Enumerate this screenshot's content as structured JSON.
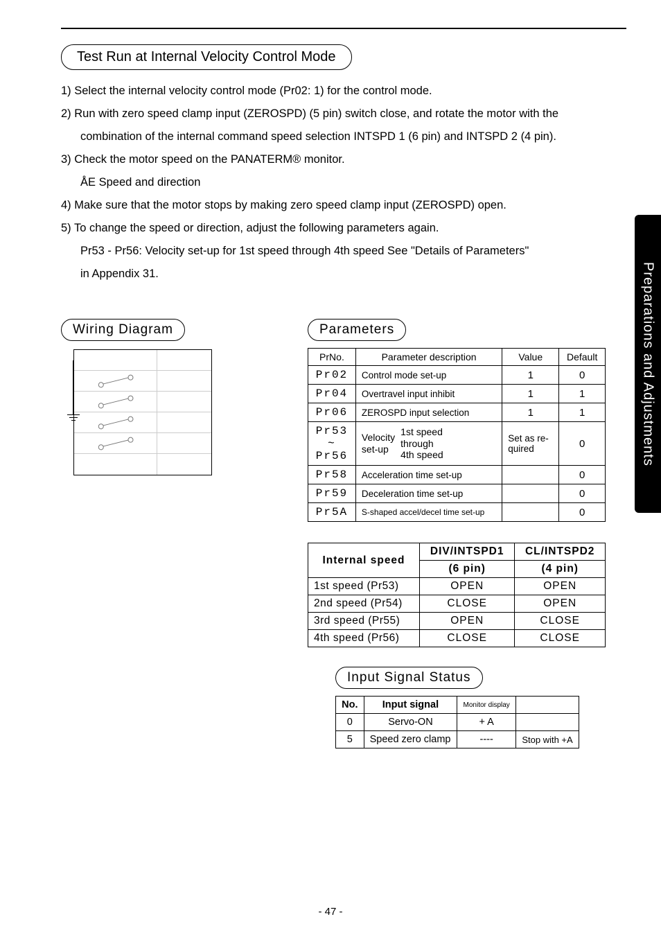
{
  "side_tab": "Preparations and Adjustments",
  "section_title": "Test Run at Internal Velocity Control Mode",
  "steps": {
    "s1": "1) Select the internal velocity control mode (Pr02: 1) for the control mode.",
    "s2": "2) Run with zero speed clamp input (ZEROSPD) (5 pin) switch close, and rotate the motor with the",
    "s2b": "combination of the internal command speed selection INTSPD 1 (6 pin) and INTSPD 2 (4 pin).",
    "s3": "3) Check the motor speed on the PANATERM® monitor.",
    "s3b": "ÅE Speed and direction",
    "s4": "4) Make sure that the motor stops by making zero speed clamp input (ZEROSPD) open.",
    "s5": "5) To change the speed or direction, adjust the following parameters again.",
    "s5b": "Pr53 - Pr56:  Velocity set-up for 1st speed through 4th speed  See \"Details of Parameters\"",
    "s5c": "in Appendix 31."
  },
  "wiring_heading": "Wiring Diagram",
  "params_heading": "Parameters",
  "params_headers": {
    "prno": "PrNo.",
    "desc": "Parameter description",
    "value": "Value",
    "default": "Default"
  },
  "params_rows": [
    {
      "prno": "Pr02",
      "desc": "Control mode set-up",
      "value": "1",
      "default": "0"
    },
    {
      "prno": "Pr04",
      "desc": "Overtravel input inhibit",
      "value": "1",
      "default": "1"
    },
    {
      "prno": "Pr06",
      "desc": "ZEROSPD input selection",
      "value": "1",
      "default": "1"
    }
  ],
  "params_velocity": {
    "prno_top": "Pr53",
    "prno_mid": "~",
    "prno_bot": "Pr56",
    "left_top": "Velocity",
    "left_bot": "set-up",
    "right_top": "1st speed",
    "right_mid": "through",
    "right_bot": "4th speed",
    "value_top": "Set as re-",
    "value_bot": "quired",
    "default": "0"
  },
  "params_tail": [
    {
      "prno": "Pr58",
      "desc": "Acceleration time set-up",
      "value": "",
      "default": "0"
    },
    {
      "prno": "Pr59",
      "desc": "Deceleration time set-up",
      "value": "",
      "default": "0"
    },
    {
      "prno": "Pr5A",
      "desc": "S-shaped accel/decel time set-up",
      "value": "",
      "default": "0"
    }
  ],
  "intspd_headers": {
    "c0": "Internal speed",
    "c1": "DIV/INTSPD1",
    "c2": "CL/INTSPD2",
    "c1b": "(6 pin)",
    "c2b": "(4 pin)"
  },
  "intspd_rows": [
    {
      "lbl": "1st speed (Pr53)",
      "c1": "OPEN",
      "c2": "OPEN"
    },
    {
      "lbl": "2nd speed (Pr54)",
      "c1": "CLOSE",
      "c2": "OPEN"
    },
    {
      "lbl": "3rd speed (Pr55)",
      "c1": "OPEN",
      "c2": "CLOSE"
    },
    {
      "lbl": "4th speed (Pr56)",
      "c1": "CLOSE",
      "c2": "CLOSE"
    }
  ],
  "sig_heading": "Input Signal Status",
  "sig_headers": {
    "no": "No.",
    "sig": "Input signal",
    "mon": "Monitor display",
    "note": ""
  },
  "sig_rows": [
    {
      "no": "0",
      "sig": "Servo-ON",
      "mon": "+ A",
      "note": ""
    },
    {
      "no": "5",
      "sig": "Speed zero clamp",
      "mon": "----",
      "note": "Stop with +A"
    }
  ],
  "page_num": "- 47 -"
}
